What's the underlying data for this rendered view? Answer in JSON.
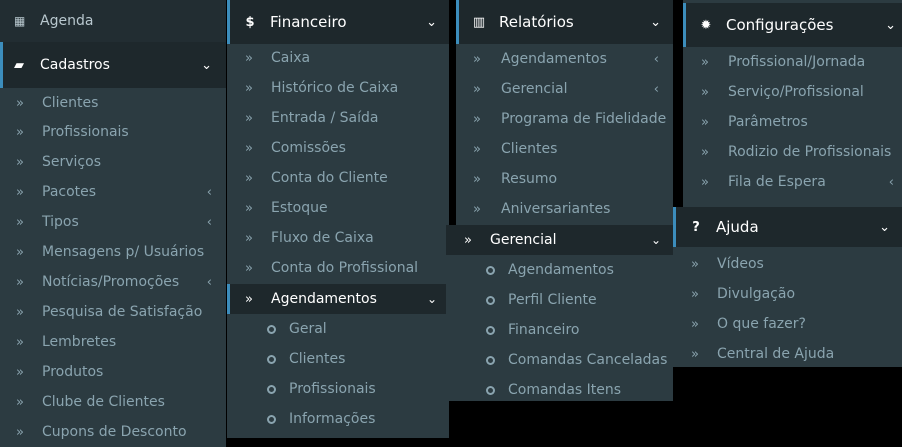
{
  "col1": {
    "agenda": "Agenda",
    "cadastros": "Cadastros",
    "items": [
      "Clientes",
      "Profissionais",
      "Serviços",
      "Pacotes",
      "Tipos",
      "Mensagens p/ Usuários",
      "Notícias/Promoções",
      "Pesquisa de Satisfação",
      "Lembretes",
      "Produtos",
      "Clube de Clientes",
      "Cupons de Desconto"
    ]
  },
  "col2": {
    "title": "Financeiro",
    "items": [
      "Caixa",
      "Histórico de Caixa",
      "Entrada / Saída",
      "Comissões",
      "Conta do Cliente",
      "Estoque",
      "Fluxo de Caixa",
      "Conta do Profissional"
    ],
    "sub_title": "Agendamentos",
    "sub_items": [
      "Geral",
      "Clientes",
      "Profissionais",
      "Informações"
    ]
  },
  "col3": {
    "title": "Relatórios",
    "items": [
      "Agendamentos",
      "Gerencial",
      "Programa de Fidelidade",
      "Clientes",
      "Resumo",
      "Aniversariantes"
    ],
    "sub_title": "Gerencial",
    "sub_items": [
      "Agendamentos",
      "Perfil Cliente",
      "Financeiro",
      "Comandas Canceladas",
      "Comandas Itens"
    ]
  },
  "col4": {
    "title": "Configurações",
    "items": [
      "Profissional/Jornada",
      "Serviço/Profissional",
      "Parâmetros",
      "Rodizio de Profissionais",
      "Fila de Espera"
    ]
  },
  "col5": {
    "title": "Ajuda",
    "items": [
      "Vídeos",
      "Divulgação",
      "O que fazer?",
      "Central de Ajuda"
    ]
  },
  "icons": {
    "bullet": "»",
    "chevron_down": "⌄",
    "chevron_left": "‹"
  }
}
